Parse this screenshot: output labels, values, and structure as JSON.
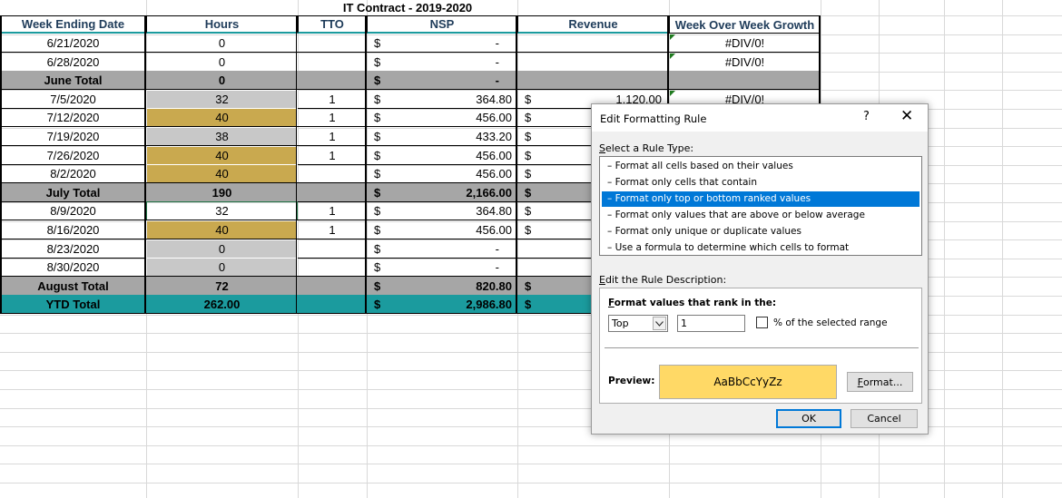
{
  "sheet": {
    "title": "IT Contract - 2019-2020",
    "headers": [
      "Week Ending Date",
      "Hours",
      "TTO",
      "NSP",
      "Revenue",
      "Week Over Week Growth"
    ],
    "rows": [
      {
        "date": "6/21/2020",
        "hours": "0",
        "tto": "",
        "nsp_sign": "$",
        "nsp": "-",
        "rev_sign": "",
        "revenue": "",
        "growth": "#DIV/0!",
        "type": "normal",
        "hours_fill": ""
      },
      {
        "date": "6/28/2020",
        "hours": "0",
        "tto": "",
        "nsp_sign": "$",
        "nsp": "-",
        "rev_sign": "",
        "revenue": "",
        "growth": "#DIV/0!",
        "type": "normal",
        "hours_fill": ""
      },
      {
        "date": "June Total",
        "hours": "0",
        "tto": "",
        "nsp_sign": "$",
        "nsp": "-",
        "rev_sign": "",
        "revenue": "",
        "growth": "",
        "type": "subtotal",
        "hours_fill": ""
      },
      {
        "date": "7/5/2020",
        "hours": "32",
        "tto": "1",
        "nsp_sign": "$",
        "nsp": "364.80",
        "rev_sign": "$",
        "revenue": "1,120.00",
        "growth": "#DIV/0!",
        "type": "normal",
        "hours_fill": "grey"
      },
      {
        "date": "7/12/2020",
        "hours": "40",
        "tto": "1",
        "nsp_sign": "$",
        "nsp": "456.00",
        "rev_sign": "$",
        "revenue": "",
        "growth": "",
        "type": "normal",
        "hours_fill": "gold"
      },
      {
        "date": "7/19/2020",
        "hours": "38",
        "tto": "1",
        "nsp_sign": "$",
        "nsp": "433.20",
        "rev_sign": "$",
        "revenue": "",
        "growth": "",
        "type": "normal",
        "hours_fill": "grey"
      },
      {
        "date": "7/26/2020",
        "hours": "40",
        "tto": "1",
        "nsp_sign": "$",
        "nsp": "456.00",
        "rev_sign": "$",
        "revenue": "",
        "growth": "",
        "type": "normal",
        "hours_fill": "gold"
      },
      {
        "date": "8/2/2020",
        "hours": "40",
        "tto": "",
        "nsp_sign": "$",
        "nsp": "456.00",
        "rev_sign": "$",
        "revenue": "",
        "growth": "",
        "type": "normal",
        "hours_fill": "gold"
      },
      {
        "date": "July Total",
        "hours": "190",
        "tto": "",
        "nsp_sign": "$",
        "nsp": "2,166.00",
        "rev_sign": "$",
        "revenue": "",
        "growth": "",
        "type": "subtotal",
        "hours_fill": ""
      },
      {
        "date": "8/9/2020",
        "hours": "32",
        "tto": "1",
        "nsp_sign": "$",
        "nsp": "364.80",
        "rev_sign": "$",
        "revenue": "",
        "growth": "",
        "type": "normal",
        "hours_fill": "selected"
      },
      {
        "date": "8/16/2020",
        "hours": "40",
        "tto": "1",
        "nsp_sign": "$",
        "nsp": "456.00",
        "rev_sign": "$",
        "revenue": "",
        "growth": "",
        "type": "normal",
        "hours_fill": "gold"
      },
      {
        "date": "8/23/2020",
        "hours": "0",
        "tto": "",
        "nsp_sign": "$",
        "nsp": "-",
        "rev_sign": "",
        "revenue": "",
        "growth": "",
        "type": "normal",
        "hours_fill": "grey"
      },
      {
        "date": "8/30/2020",
        "hours": "0",
        "tto": "",
        "nsp_sign": "$",
        "nsp": "-",
        "rev_sign": "",
        "revenue": "",
        "growth": "",
        "type": "normal",
        "hours_fill": "grey"
      },
      {
        "date": "August Total",
        "hours": "72",
        "tto": "",
        "nsp_sign": "$",
        "nsp": "820.80",
        "rev_sign": "$",
        "revenue": "",
        "growth": "",
        "type": "subtotal",
        "hours_fill": ""
      },
      {
        "date": "YTD Total",
        "hours": "262.00",
        "tto": "",
        "nsp_sign": "$",
        "nsp": "2,986.80",
        "rev_sign": "$",
        "revenue": "",
        "growth": "",
        "type": "ytd",
        "hours_fill": ""
      }
    ],
    "colors": {
      "subtotal": "#a6a6a6",
      "ytd": "#1b9b9e",
      "gold": "#c9a94f",
      "grey": "#c8c8c8"
    }
  },
  "dialog": {
    "title": "Edit Formatting Rule",
    "help": "?",
    "close": "✕",
    "rule_type_label": "Select a Rule Type:",
    "rules": [
      "Format all cells based on their values",
      "Format only cells that contain",
      "Format only top or bottom ranked values",
      "Format only values that are above or below average",
      "Format only unique or duplicate values",
      "Use a formula to determine which cells to format"
    ],
    "selected_rule_index": 2,
    "desc_label": "Edit the Rule Description:",
    "format_values_label": "Format values that rank in the:",
    "rank_direction": "Top",
    "rank_value": "1",
    "percent_label": "% of the selected range",
    "percent_checked": false,
    "preview_label": "Preview:",
    "preview_text": "AaBbCcYyZz",
    "preview_color": "#ffd966",
    "format_button": "Format...",
    "ok_button": "OK",
    "cancel_button": "Cancel"
  }
}
